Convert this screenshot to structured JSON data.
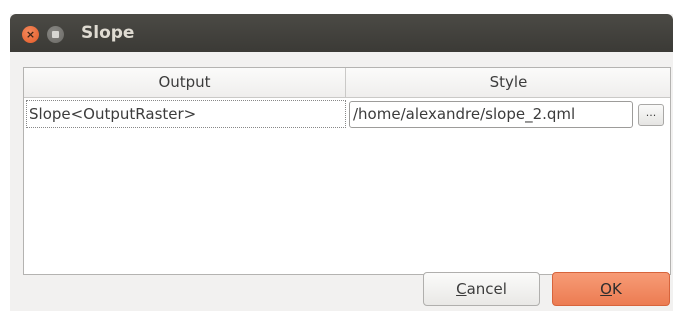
{
  "window": {
    "title": "Slope",
    "controls": {
      "close": "×"
    }
  },
  "table": {
    "headers": [
      "Output",
      "Style"
    ],
    "rows": [
      {
        "output": "Slope<OutputRaster>",
        "style": "/home/alexandre/slope_2.qml",
        "browse_label": "..."
      }
    ]
  },
  "buttons": {
    "cancel_mnemonic": "C",
    "cancel_rest": "ancel",
    "ok_mnemonic": "O",
    "ok_rest": "K"
  }
}
